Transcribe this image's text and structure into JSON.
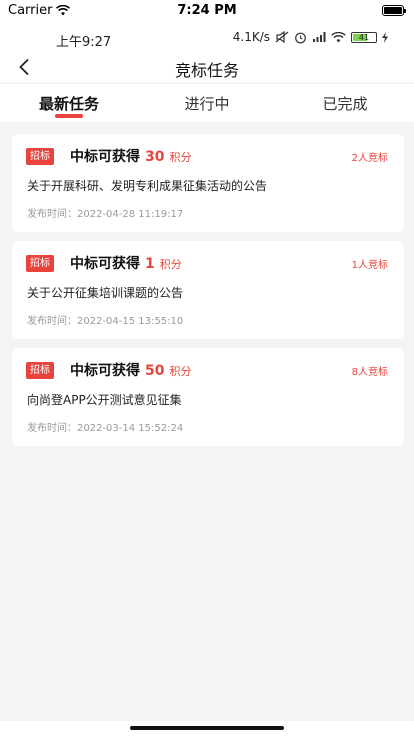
{
  "ios_status": {
    "carrier": "Carrier",
    "time": "7:24 PM"
  },
  "android_status": {
    "time": "上午9:27",
    "speed": "4.1K/s",
    "battery": "41"
  },
  "nav": {
    "title": "竞标任务"
  },
  "tabs": [
    {
      "label": "最新任务",
      "active": true
    },
    {
      "label": "进行中",
      "active": false
    },
    {
      "label": "已完成",
      "active": false
    }
  ],
  "cards": [
    {
      "badge": "招标",
      "prefix": "中标可获得",
      "points": "30",
      "unit": "积分",
      "bidders": "2人竞标",
      "title": "关于开展科研、发明专利成果征集活动的公告",
      "date": "发布时间：2022-04-28 11:19:17"
    },
    {
      "badge": "招标",
      "prefix": "中标可获得",
      "points": "1",
      "unit": "积分",
      "bidders": "1人竞标",
      "title": "关于公开征集培训课题的公告",
      "date": "发布时间：2022-04-15 13:55:10"
    },
    {
      "badge": "招标",
      "prefix": "中标可获得",
      "points": "50",
      "unit": "积分",
      "bidders": "8人竞标",
      "title": "向尚登APP公开测试意见征集",
      "date": "发布时间：2022-03-14 15:52:24"
    }
  ],
  "colors": {
    "accent": "#e8443d",
    "background": "#f4f4f4"
  }
}
